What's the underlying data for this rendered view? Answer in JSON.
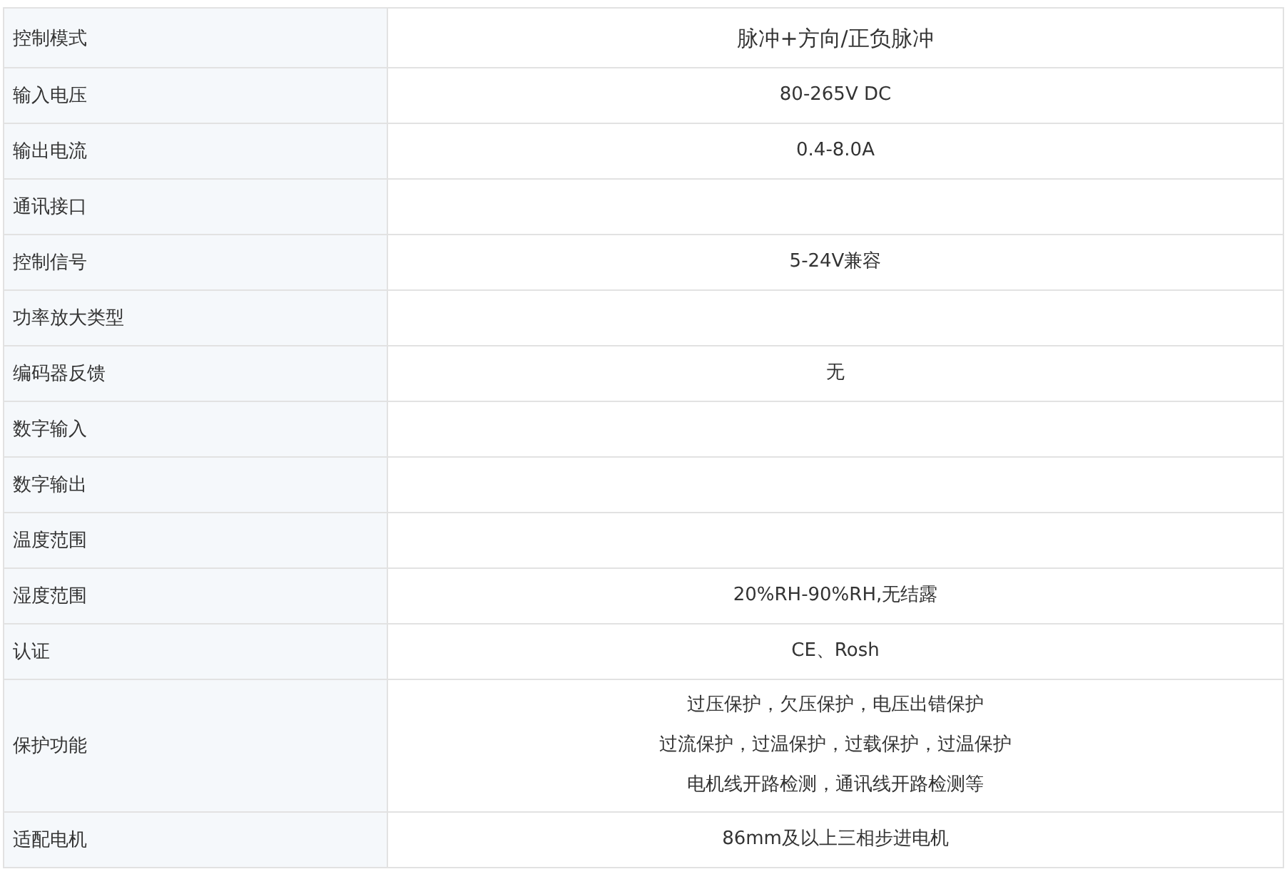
{
  "spec_table": {
    "rows": [
      {
        "label": "控制模式",
        "lines": [
          "脉冲+方向/正负脉冲"
        ]
      },
      {
        "label": "输入电压",
        "lines": [
          "80-265V DC"
        ]
      },
      {
        "label": "输出电流",
        "lines": [
          "0.4-8.0A"
        ]
      },
      {
        "label": "通讯接口"
      },
      {
        "label": "控制信号",
        "lines": [
          "5-24V兼容"
        ]
      },
      {
        "label": "功率放大类型"
      },
      {
        "label": "编码器反馈",
        "lines": [
          "无"
        ]
      },
      {
        "label": "数字输入"
      },
      {
        "label": "数字输出"
      },
      {
        "label": "温度范围"
      },
      {
        "label": "湿度范围",
        "lines": [
          "20%RH-90%RH,无结露"
        ]
      },
      {
        "label": "认证",
        "lines": [
          "CE、Rosh"
        ]
      },
      {
        "label": "保护功能",
        "lines": [
          "过压保护，欠压保护，电压出错保护",
          "过流保护，过温保护，过载保护，过温保护",
          "电机线开路检测，通讯线开路检测等"
        ]
      },
      {
        "label": "适配电机",
        "lines": [
          "86mm及以上三相步进电机"
        ]
      }
    ]
  }
}
